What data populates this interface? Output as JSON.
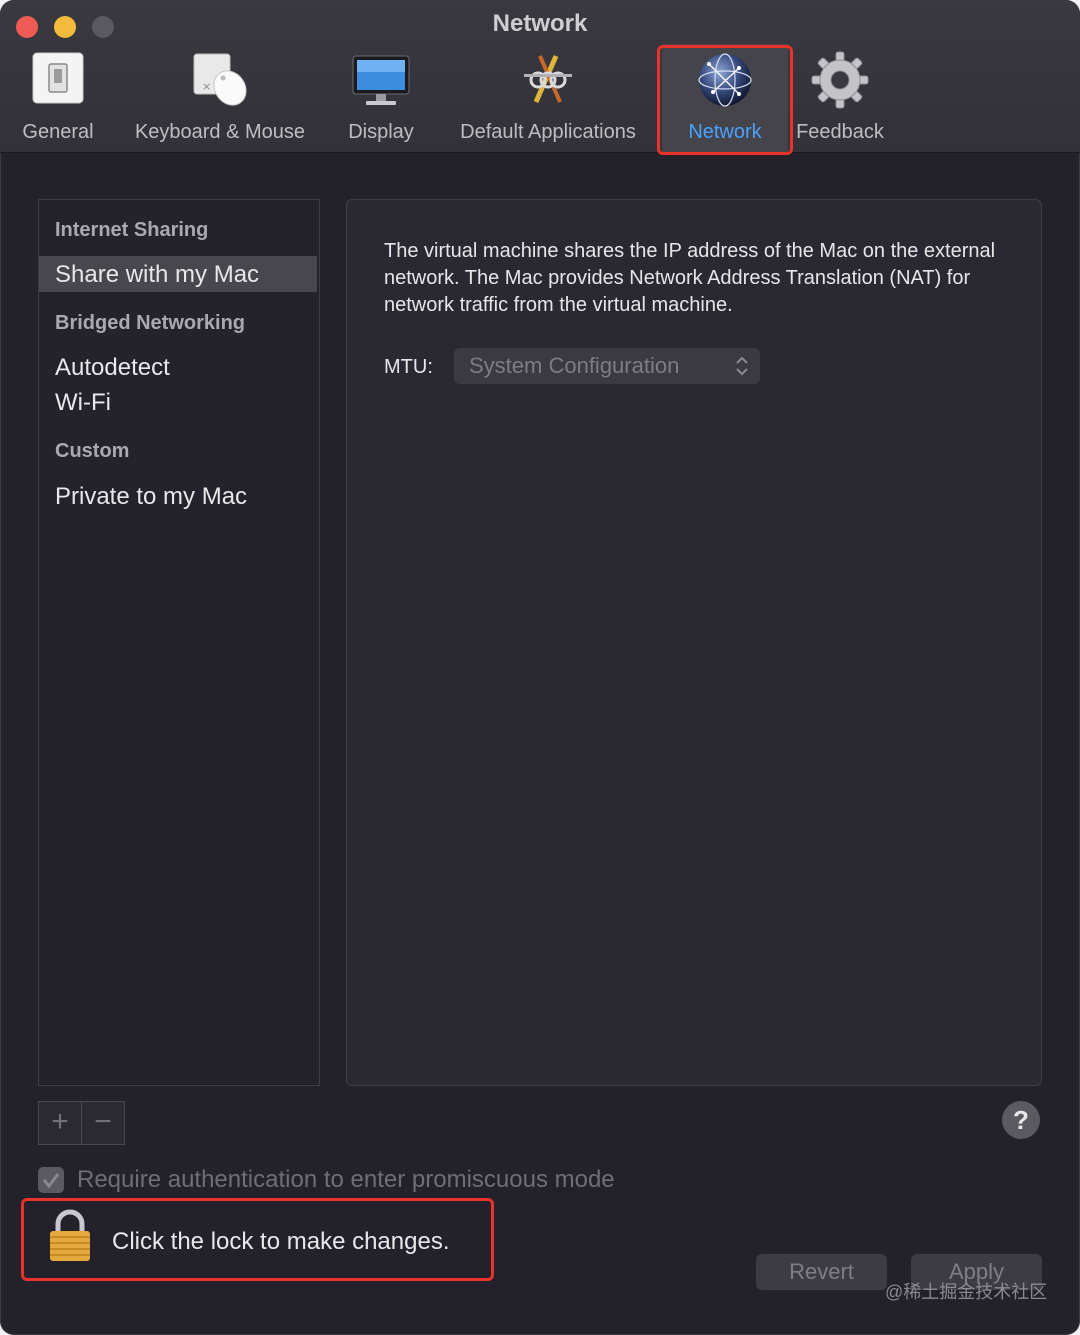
{
  "window": {
    "title": "Network"
  },
  "toolbar": {
    "items": [
      {
        "label": "General",
        "icon": "general-switch-icon"
      },
      {
        "label": "Keyboard & Mouse",
        "icon": "keyboard-mouse-icon"
      },
      {
        "label": "Display",
        "icon": "display-monitor-icon"
      },
      {
        "label": "Default Applications",
        "icon": "default-applications-icon"
      },
      {
        "label": "Network",
        "icon": "network-globe-icon",
        "active": true
      },
      {
        "label": "Feedback",
        "icon": "gear-feedback-icon"
      }
    ]
  },
  "sidebar": {
    "sections": [
      {
        "header": "Internet Sharing",
        "items": [
          "Share with my Mac"
        ]
      },
      {
        "header": "Bridged Networking",
        "items": [
          "Autodetect",
          "Wi-Fi"
        ]
      },
      {
        "header": "Custom",
        "items": [
          "Private to my Mac"
        ]
      }
    ],
    "selected": "Share with my Mac"
  },
  "main": {
    "description": "The virtual machine shares the IP address of the Mac on the external network. The Mac provides Network Address Translation (NAT) for network traffic from the virtual machine.",
    "mtu_label": "MTU:",
    "mtu_value": "System Configuration"
  },
  "controls": {
    "add": "+",
    "remove": "−",
    "help": "?",
    "require_auth_label": "Require authentication to enter promiscuous mode",
    "require_auth_checked": true,
    "lock_text": "Click the lock to make changes.",
    "revert": "Revert",
    "apply": "Apply"
  },
  "watermark": "@稀土掘金技术社区",
  "colors": {
    "accent": "#4aa1ff",
    "highlight": "#e8322b",
    "background": "#23222b"
  }
}
